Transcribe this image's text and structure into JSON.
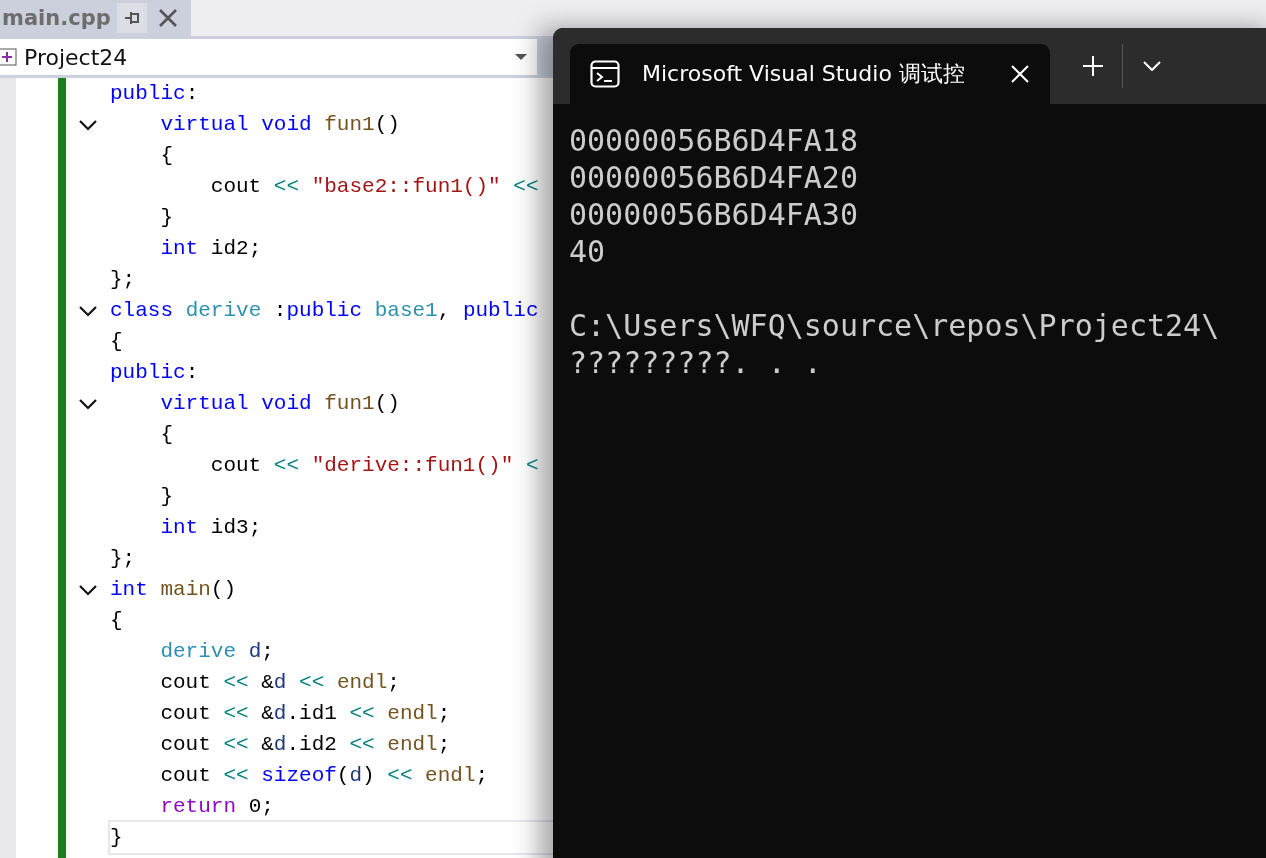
{
  "editor": {
    "tab": {
      "title": "main.cpp"
    },
    "project_selector": {
      "value": "Project24"
    },
    "lines": [
      {
        "fold": false,
        "current": false,
        "tokens": [
          {
            "kind": "keyword",
            "text": "public"
          },
          {
            "kind": "plain",
            "text": ":"
          }
        ]
      },
      {
        "fold": true,
        "current": false,
        "tokens": [
          {
            "kind": "keyword",
            "text": "    virtual void "
          },
          {
            "kind": "function",
            "text": "fun1"
          },
          {
            "kind": "plain",
            "text": "()"
          }
        ]
      },
      {
        "fold": false,
        "current": false,
        "tokens": [
          {
            "kind": "plain",
            "text": "    {"
          }
        ]
      },
      {
        "fold": false,
        "current": false,
        "tokens": [
          {
            "kind": "plain",
            "text": "        cout "
          },
          {
            "kind": "operator",
            "text": "<< "
          },
          {
            "kind": "string",
            "text": "\"base2::fun1()\" "
          },
          {
            "kind": "operator",
            "text": "<<"
          }
        ]
      },
      {
        "fold": false,
        "current": false,
        "tokens": [
          {
            "kind": "plain",
            "text": "    }"
          }
        ]
      },
      {
        "fold": false,
        "current": false,
        "tokens": [
          {
            "kind": "keyword",
            "text": "    int "
          },
          {
            "kind": "plain",
            "text": "id2;"
          }
        ]
      },
      {
        "fold": false,
        "current": false,
        "tokens": [
          {
            "kind": "plain",
            "text": "};"
          }
        ]
      },
      {
        "fold": true,
        "current": false,
        "tokens": [
          {
            "kind": "keyword",
            "text": "class "
          },
          {
            "kind": "type",
            "text": "derive "
          },
          {
            "kind": "plain",
            "text": ":"
          },
          {
            "kind": "keyword",
            "text": "public "
          },
          {
            "kind": "type",
            "text": "base1"
          },
          {
            "kind": "plain",
            "text": ", "
          },
          {
            "kind": "keyword",
            "text": "public"
          }
        ]
      },
      {
        "fold": false,
        "current": false,
        "tokens": [
          {
            "kind": "plain",
            "text": "{"
          }
        ]
      },
      {
        "fold": false,
        "current": false,
        "tokens": [
          {
            "kind": "keyword",
            "text": "public"
          },
          {
            "kind": "plain",
            "text": ":"
          }
        ]
      },
      {
        "fold": true,
        "current": false,
        "tokens": [
          {
            "kind": "keyword",
            "text": "    virtual void "
          },
          {
            "kind": "function",
            "text": "fun1"
          },
          {
            "kind": "plain",
            "text": "()"
          }
        ]
      },
      {
        "fold": false,
        "current": false,
        "tokens": [
          {
            "kind": "plain",
            "text": "    {"
          }
        ]
      },
      {
        "fold": false,
        "current": false,
        "tokens": [
          {
            "kind": "plain",
            "text": "        cout "
          },
          {
            "kind": "operator",
            "text": "<< "
          },
          {
            "kind": "string",
            "text": "\"derive::fun1()\" "
          },
          {
            "kind": "operator",
            "text": "<"
          }
        ]
      },
      {
        "fold": false,
        "current": false,
        "tokens": [
          {
            "kind": "plain",
            "text": "    }"
          }
        ]
      },
      {
        "fold": false,
        "current": false,
        "tokens": [
          {
            "kind": "keyword",
            "text": "    int "
          },
          {
            "kind": "plain",
            "text": "id3;"
          }
        ]
      },
      {
        "fold": false,
        "current": false,
        "tokens": [
          {
            "kind": "plain",
            "text": "};"
          }
        ]
      },
      {
        "fold": true,
        "current": false,
        "tokens": [
          {
            "kind": "keyword",
            "text": "int "
          },
          {
            "kind": "function",
            "text": "main"
          },
          {
            "kind": "plain",
            "text": "()"
          }
        ]
      },
      {
        "fold": false,
        "current": false,
        "tokens": [
          {
            "kind": "plain",
            "text": "{"
          }
        ]
      },
      {
        "fold": false,
        "current": false,
        "tokens": [
          {
            "kind": "type",
            "text": "    derive "
          },
          {
            "kind": "variable",
            "text": "d"
          },
          {
            "kind": "plain",
            "text": ";"
          }
        ]
      },
      {
        "fold": false,
        "current": false,
        "tokens": [
          {
            "kind": "plain",
            "text": "    cout "
          },
          {
            "kind": "operator",
            "text": "<< "
          },
          {
            "kind": "plain",
            "text": "&"
          },
          {
            "kind": "variable",
            "text": "d "
          },
          {
            "kind": "operator",
            "text": "<< "
          },
          {
            "kind": "function",
            "text": "endl"
          },
          {
            "kind": "plain",
            "text": ";"
          }
        ]
      },
      {
        "fold": false,
        "current": false,
        "tokens": [
          {
            "kind": "plain",
            "text": "    cout "
          },
          {
            "kind": "operator",
            "text": "<< "
          },
          {
            "kind": "plain",
            "text": "&"
          },
          {
            "kind": "variable",
            "text": "d"
          },
          {
            "kind": "plain",
            "text": ".id1 "
          },
          {
            "kind": "operator",
            "text": "<< "
          },
          {
            "kind": "function",
            "text": "endl"
          },
          {
            "kind": "plain",
            "text": ";"
          }
        ]
      },
      {
        "fold": false,
        "current": false,
        "tokens": [
          {
            "kind": "plain",
            "text": "    cout "
          },
          {
            "kind": "operator",
            "text": "<< "
          },
          {
            "kind": "plain",
            "text": "&"
          },
          {
            "kind": "variable",
            "text": "d"
          },
          {
            "kind": "plain",
            "text": ".id2 "
          },
          {
            "kind": "operator",
            "text": "<< "
          },
          {
            "kind": "function",
            "text": "endl"
          },
          {
            "kind": "plain",
            "text": ";"
          }
        ]
      },
      {
        "fold": false,
        "current": false,
        "tokens": [
          {
            "kind": "plain",
            "text": "    cout "
          },
          {
            "kind": "operator",
            "text": "<< "
          },
          {
            "kind": "keyword",
            "text": "sizeof"
          },
          {
            "kind": "plain",
            "text": "("
          },
          {
            "kind": "variable",
            "text": "d"
          },
          {
            "kind": "plain",
            "text": ") "
          },
          {
            "kind": "operator",
            "text": "<< "
          },
          {
            "kind": "function",
            "text": "endl"
          },
          {
            "kind": "plain",
            "text": ";"
          }
        ]
      },
      {
        "fold": false,
        "current": false,
        "tokens": [
          {
            "kind": "control",
            "text": "    return "
          },
          {
            "kind": "plain",
            "text": "0;"
          }
        ]
      },
      {
        "fold": false,
        "current": true,
        "tokens": [
          {
            "kind": "plain",
            "text": "}"
          }
        ]
      }
    ]
  },
  "console": {
    "tab": {
      "title": "Microsoft Visual Studio 调试控"
    },
    "output": [
      "00000056B6D4FA18",
      "00000056B6D4FA20",
      "00000056B6D4FA30",
      "40"
    ],
    "exit_message": [
      "C:\\Users\\WFQ\\source\\repos\\Project24\\",
      "?????????. . ."
    ]
  }
}
